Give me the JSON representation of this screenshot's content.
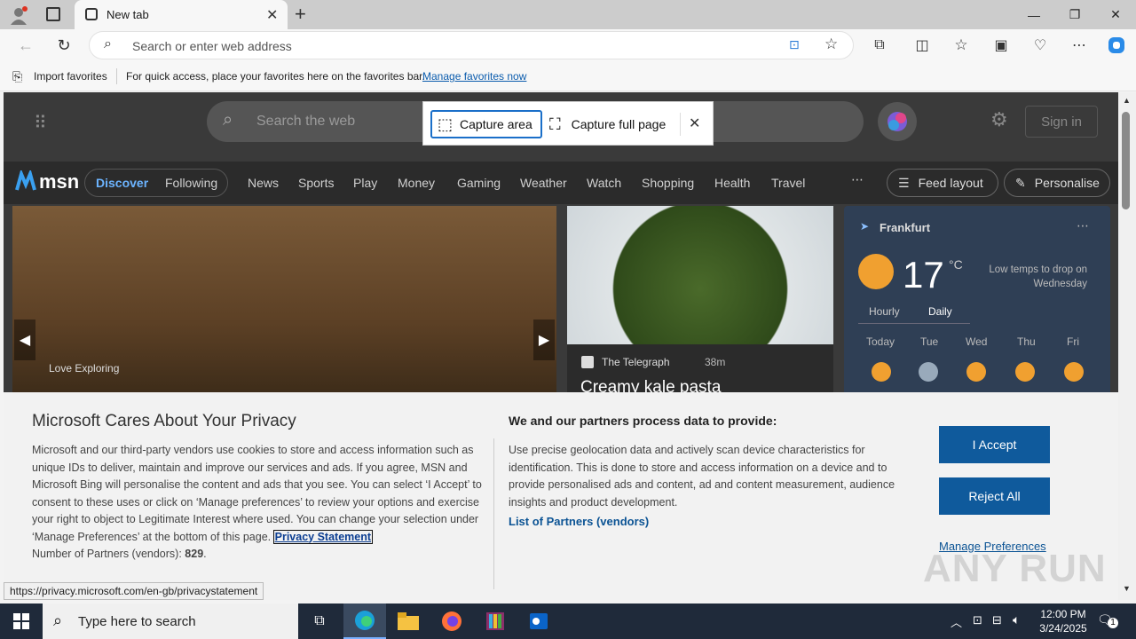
{
  "browser": {
    "tab_title": "New tab",
    "address_placeholder": "Search or enter web address"
  },
  "favorites_bar": {
    "import": "Import favorites",
    "hint": "For quick access, place your favorites here on the favorites bar.",
    "manage_link": "Manage favorites now"
  },
  "capture": {
    "area": "Capture area",
    "full": "Capture full page"
  },
  "msn": {
    "logo": "msn",
    "search_placeholder": "Search the web",
    "sign_in": "Sign in",
    "nav": [
      "Discover",
      "Following",
      "News",
      "Sports",
      "Play",
      "Money",
      "Gaming",
      "Weather",
      "Watch",
      "Shopping",
      "Health",
      "Travel"
    ],
    "feed_layout": "Feed layout",
    "personalise": "Personalise",
    "hero_source": "Love Exploring",
    "card_source": "The Telegraph",
    "card_time": "38m",
    "card_title": "Creamy kale pasta",
    "weather": {
      "city": "Frankfurt",
      "temp": "17",
      "unit": "°C",
      "note": "Low temps to drop on Wednesday",
      "tabs": [
        "Hourly",
        "Daily"
      ],
      "days": [
        "Today",
        "Tue",
        "Wed",
        "Thu",
        "Fri"
      ]
    }
  },
  "privacy": {
    "title": "Microsoft Cares About Your Privacy",
    "body": "Microsoft and our third-party vendors use cookies to store and access information such as unique IDs to deliver, maintain and improve our services and ads. If you agree, MSN and Microsoft Bing will personalise the content and ads that you see. You can select ‘I Accept’ to consent to these uses or click on ‘Manage preferences’ to review your options and exercise your right to object to Legitimate Interest where used. You can change your selection under ‘Manage Preferences’ at the bottom of this page.",
    "privacy_link": "Privacy Statement",
    "partners_count_label": "Number of Partners (vendors):",
    "partners_count": "829",
    "heading2": "We and our partners process data to provide:",
    "body2": "Use precise geolocation data and actively scan device characteristics for identification. This is done to store and access information on a device and to provide personalised ads and content, ad and content measurement, audience insights and product development.",
    "partners_link": "List of Partners (vendors)",
    "accept": "I Accept",
    "reject": "Reject All",
    "manage": "Manage Preferences"
  },
  "status_url": "https://privacy.microsoft.com/en-gb/privacystatement",
  "watermark": "ANY RUN",
  "taskbar": {
    "search_placeholder": "Type here to search",
    "time": "12:00 PM",
    "date": "3/24/2025",
    "notification_count": "1"
  }
}
